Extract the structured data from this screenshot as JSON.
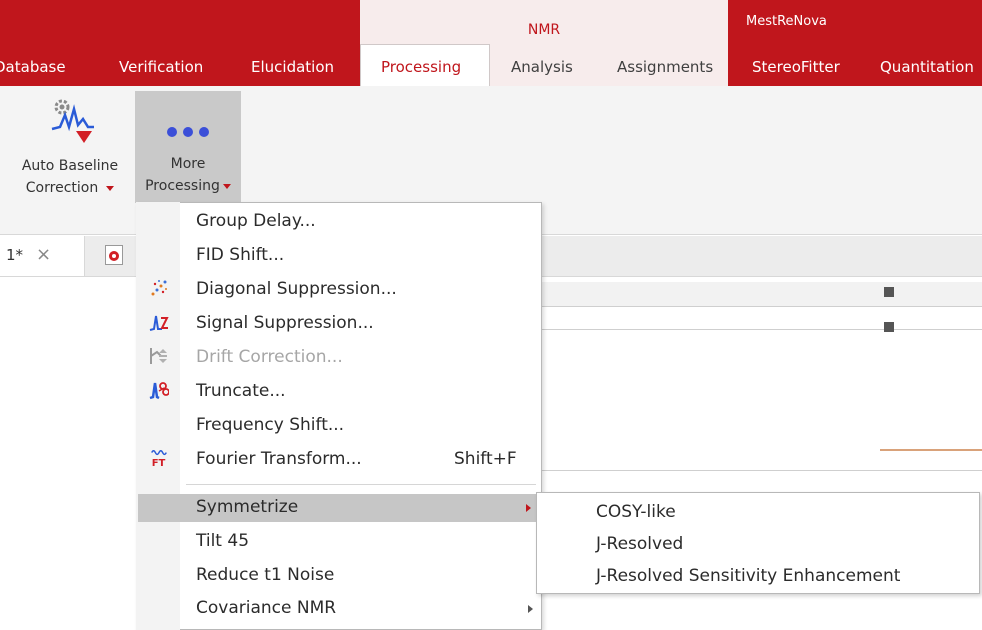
{
  "ribbon": {
    "contexts": {
      "nmr": "NMR",
      "mestrenova": "MestReNova"
    },
    "tabs": [
      "Database",
      "Verification",
      "Elucidation",
      "Processing",
      "Analysis",
      "Assignments",
      "StereoFitter",
      "Quantitation"
    ],
    "active_tab": "Processing",
    "buttons": {
      "auto_baseline": {
        "line1": "Auto Baseline",
        "line2": "Correction"
      },
      "more_processing": {
        "line1": "More",
        "line2": "Processing"
      }
    }
  },
  "document": {
    "tab_label": "1*",
    "close_glyph": "×"
  },
  "menu": {
    "items": [
      {
        "label": "Group Delay...",
        "icon": ""
      },
      {
        "label": "FID Shift...",
        "icon": ""
      },
      {
        "label": "Diagonal Suppression...",
        "icon": "diagonal-suppression-icon"
      },
      {
        "label": "Signal Suppression...",
        "icon": "signal-suppression-icon"
      },
      {
        "label": "Drift Correction...",
        "icon": "drift-correction-icon",
        "disabled": true
      },
      {
        "label": "Truncate...",
        "icon": "truncate-icon"
      },
      {
        "label": "Frequency Shift...",
        "icon": ""
      },
      {
        "label": "Fourier Transform...",
        "icon": "fourier-transform-icon",
        "shortcut": "Shift+F"
      },
      {
        "label": "Symmetrize",
        "submenu": true,
        "highlighted": true
      },
      {
        "label": "Tilt 45"
      },
      {
        "label": "Reduce t1 Noise"
      },
      {
        "label": "Covariance NMR",
        "submenu": true
      }
    ]
  },
  "submenu": {
    "items": [
      "COSY-like",
      "J-Resolved",
      "J-Resolved Sensitivity Enhancement"
    ]
  },
  "colors": {
    "brand": "#c0161c",
    "highlight": "#c6c6c6"
  }
}
